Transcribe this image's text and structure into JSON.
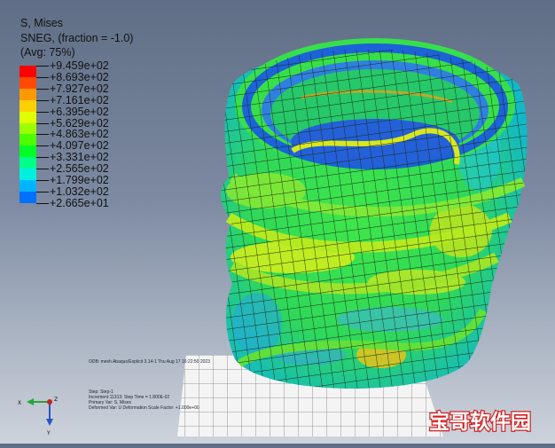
{
  "legend": {
    "title_line1": "S, Mises",
    "title_line2": "SNEG, (fraction = -1.0)",
    "title_line3": "(Avg: 75%)",
    "values": [
      "+9.459e+02",
      "+8.693e+02",
      "+7.927e+02",
      "+7.161e+02",
      "+6.395e+02",
      "+5.629e+02",
      "+4.863e+02",
      "+4.097e+02",
      "+3.331e+02",
      "+2.565e+02",
      "+1.799e+02",
      "+1.032e+02",
      "+2.665e+01"
    ],
    "colors": [
      "#ff0000",
      "#ff4a00",
      "#ff9900",
      "#ffd000",
      "#e0ff00",
      "#9cff00",
      "#4cff00",
      "#00ff24",
      "#00ff88",
      "#00f0e0",
      "#00b4ff",
      "#0070ff",
      "#0018ff"
    ]
  },
  "viewport": {
    "info_line_1": "ODB: mesh  Abaqus/Explicit 3.14-1  Thu Aug 17 16:22:50 2023",
    "info_line_2": "Step: Step-1",
    "info_line_3": "Increment  11313: Step Time = 1.800E-02",
    "info_line_4": "Primary Var: S, Mises",
    "info_line_5": "Deformed Var: U  Deformation Scale Factor: +1.000e+00",
    "triad_x": "X",
    "triad_y": "Y",
    "triad_z": "Z"
  },
  "watermark": {
    "text": "宝哥软件园"
  }
}
